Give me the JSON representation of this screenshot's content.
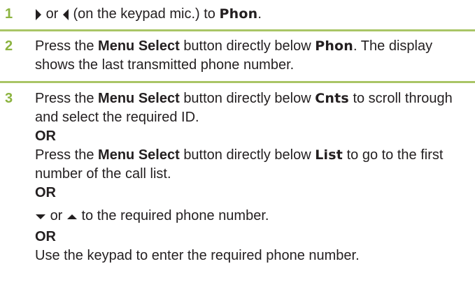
{
  "colors": {
    "step_number": "#8cb340",
    "divider": "#a9c566",
    "text": "#231f20"
  },
  "icons": {
    "right_arrow": "right-arrow-key-icon",
    "left_arrow": "left-arrow-key-icon",
    "down_arrow": "down-arrow-key-icon",
    "up_arrow": "up-arrow-key-icon"
  },
  "steps": [
    {
      "number": "1",
      "or": "or",
      "text_a": "(on the keypad mic.) to",
      "display": "Phon",
      "end": "."
    },
    {
      "number": "2",
      "press": "Press the",
      "button": "Menu Select",
      "mid": "button directly below",
      "display": "Phon",
      "rest": ". The display shows the last transmitted phone number."
    },
    {
      "number": "3",
      "line1_press": "Press the",
      "line1_button": "Menu Select",
      "line1_mid": "button directly below",
      "line1_display": "Cnts",
      "line1_rest": "to scroll through and select the required ID.",
      "or1": "OR",
      "line2_press": "Press the",
      "line2_button": "Menu Select",
      "line2_mid": "button directly below",
      "line2_display": "List",
      "line2_rest": "to go to the first number of the call list.",
      "or2": "OR",
      "line3_or": "or",
      "line3_rest": "to the required phone number.",
      "or3": "OR",
      "line4": "Use the keypad to enter the required phone number."
    }
  ]
}
